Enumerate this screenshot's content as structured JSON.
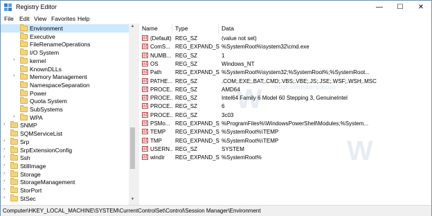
{
  "window": {
    "title": "Registry Editor",
    "controls": [
      "—",
      "☐",
      "✕"
    ]
  },
  "menu": [
    "File",
    "Edit",
    "View",
    "Favorites",
    "Help"
  ],
  "tree": {
    "items": [
      {
        "label": "Environment",
        "selected": true,
        "expandable": false
      },
      {
        "label": "Executive",
        "selected": false,
        "expandable": false
      },
      {
        "label": "FileRenameOperations",
        "selected": false,
        "expandable": false
      },
      {
        "label": "I/O System",
        "selected": false,
        "expandable": false
      },
      {
        "label": "kernel",
        "selected": false,
        "expandable": true
      },
      {
        "label": "KnownDLLs",
        "selected": false,
        "expandable": false
      },
      {
        "label": "Memory Management",
        "selected": false,
        "expandable": true
      },
      {
        "label": "NamespaceSeparation",
        "selected": false,
        "expandable": false
      },
      {
        "label": "Power",
        "selected": false,
        "expandable": false
      },
      {
        "label": "Quota System",
        "selected": false,
        "expandable": false
      },
      {
        "label": "SubSystems",
        "selected": false,
        "expandable": false
      },
      {
        "label": "WPA",
        "selected": false,
        "expandable": true
      },
      {
        "label": "SNMP",
        "selected": false,
        "expandable": true
      },
      {
        "label": "SQMServiceList",
        "selected": false,
        "expandable": false
      },
      {
        "label": "Srp",
        "selected": false,
        "expandable": true
      },
      {
        "label": "SrpExtensionConfig",
        "selected": false,
        "expandable": true
      },
      {
        "label": "Ssh",
        "selected": false,
        "expandable": true
      },
      {
        "label": "StillImage",
        "selected": false,
        "expandable": true
      },
      {
        "label": "Storage",
        "selected": false,
        "expandable": true
      },
      {
        "label": "StorageManagement",
        "selected": false,
        "expandable": true
      },
      {
        "label": "StorPort",
        "selected": false,
        "expandable": true
      },
      {
        "label": "StSec",
        "selected": false,
        "expandable": true
      }
    ]
  },
  "list": {
    "headers": [
      "Name",
      "Type",
      "Data"
    ],
    "rows": [
      {
        "name": "(Default)",
        "type": "REG_SZ",
        "data": "(value not set)"
      },
      {
        "name": "ComSpec",
        "type": "REG_EXPAND_SZ",
        "data": "%SystemRoot%\\system32\\cmd.exe"
      },
      {
        "name": "NUMBER_OF_PROCESSORS",
        "type": "REG_SZ",
        "data": "1"
      },
      {
        "name": "OS",
        "type": "REG_SZ",
        "data": "Windows_NT"
      },
      {
        "name": "Path",
        "type": "REG_EXPAND_SZ",
        "data": "%SystemRoot%\\system32;%SystemRoot%;%SystemRoot..."
      },
      {
        "name": "PATHEXT",
        "type": "REG_SZ",
        "data": ".COM;.EXE;.BAT;.CMD;.VBS;.VBE;.JS;.JSE;.WSF;.WSH;.MSC"
      },
      {
        "name": "PROCESSOR_ARCHITECTURE",
        "type": "REG_SZ",
        "data": "AMD64"
      },
      {
        "name": "PROCESSOR_IDENTIFIER",
        "type": "REG_SZ",
        "data": "Intel64 Family 6 Model 60 Stepping 3, GenuineIntel"
      },
      {
        "name": "PROCESSOR_LEVEL",
        "type": "REG_SZ",
        "data": "6"
      },
      {
        "name": "PROCESSOR_REVISION",
        "type": "REG_SZ",
        "data": "3c03"
      },
      {
        "name": "PSModulePath",
        "type": "REG_EXPAND_SZ",
        "data": "%ProgramFiles%\\WindowsPowerShell\\Modules;%System..."
      },
      {
        "name": "TEMP",
        "type": "REG_EXPAND_SZ",
        "data": "%SystemRoot%\\TEMP"
      },
      {
        "name": "TMP",
        "type": "REG_EXPAND_SZ",
        "data": "%SystemRoot%\\TEMP"
      },
      {
        "name": "USERNAME",
        "type": "REG_SZ",
        "data": "SYSTEM"
      },
      {
        "name": "windir",
        "type": "REG_EXPAND_SZ",
        "data": "%SystemRoot%"
      }
    ],
    "display_names": [
      "(Default)",
      "ComS...",
      "NUMB...",
      "OS",
      "Path",
      "PATHE...",
      "PROCE...",
      "PROCE...",
      "PROCE...",
      "PROCE...",
      "PSMo...",
      "TEMP",
      "TMP",
      "USERN...",
      "windir"
    ]
  },
  "statusbar": {
    "path": "Computer\\HKEY_LOCAL_MACHINE\\SYSTEM\\CurrentControlSet\\Control\\Session Manager\\Environment"
  },
  "watermark": "http://winaero.com",
  "colors": {
    "selection": "#cce8ff",
    "folder": "#f4d37c"
  }
}
